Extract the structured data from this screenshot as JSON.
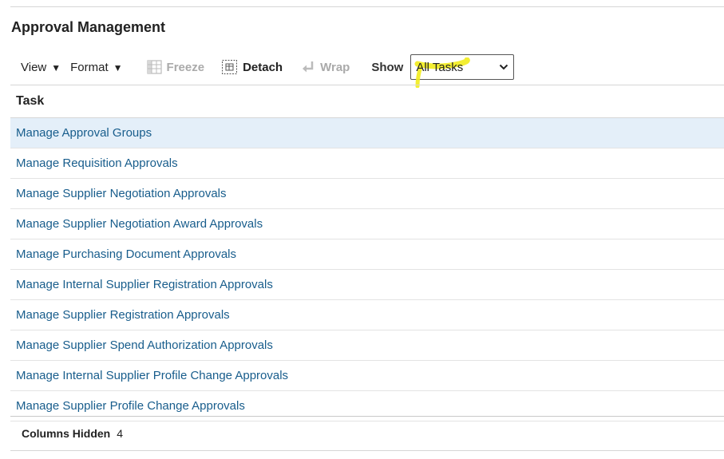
{
  "page": {
    "title": "Approval Management"
  },
  "toolbar": {
    "view_label": "View",
    "format_label": "Format",
    "freeze_label": "Freeze",
    "detach_label": "Detach",
    "wrap_label": "Wrap",
    "show_label": "Show",
    "show_value": "All Tasks"
  },
  "table": {
    "header": "Task",
    "rows": [
      "Manage Approval Groups",
      "Manage Requisition Approvals",
      "Manage Supplier Negotiation Approvals",
      "Manage Supplier Negotiation Award Approvals",
      "Manage Purchasing Document Approvals",
      "Manage Internal Supplier Registration Approvals",
      "Manage Supplier Registration Approvals",
      "Manage Supplier Spend Authorization Approvals",
      "Manage Internal Supplier Profile Change Approvals",
      "Manage Supplier Profile Change Approvals"
    ],
    "selected_row_index": 0
  },
  "footer": {
    "columns_hidden_label": "Columns Hidden",
    "columns_hidden_count": "4"
  },
  "colors": {
    "link": "#185d8c",
    "selected_row": "#e4eff9",
    "highlight": "#f2ec1c"
  }
}
